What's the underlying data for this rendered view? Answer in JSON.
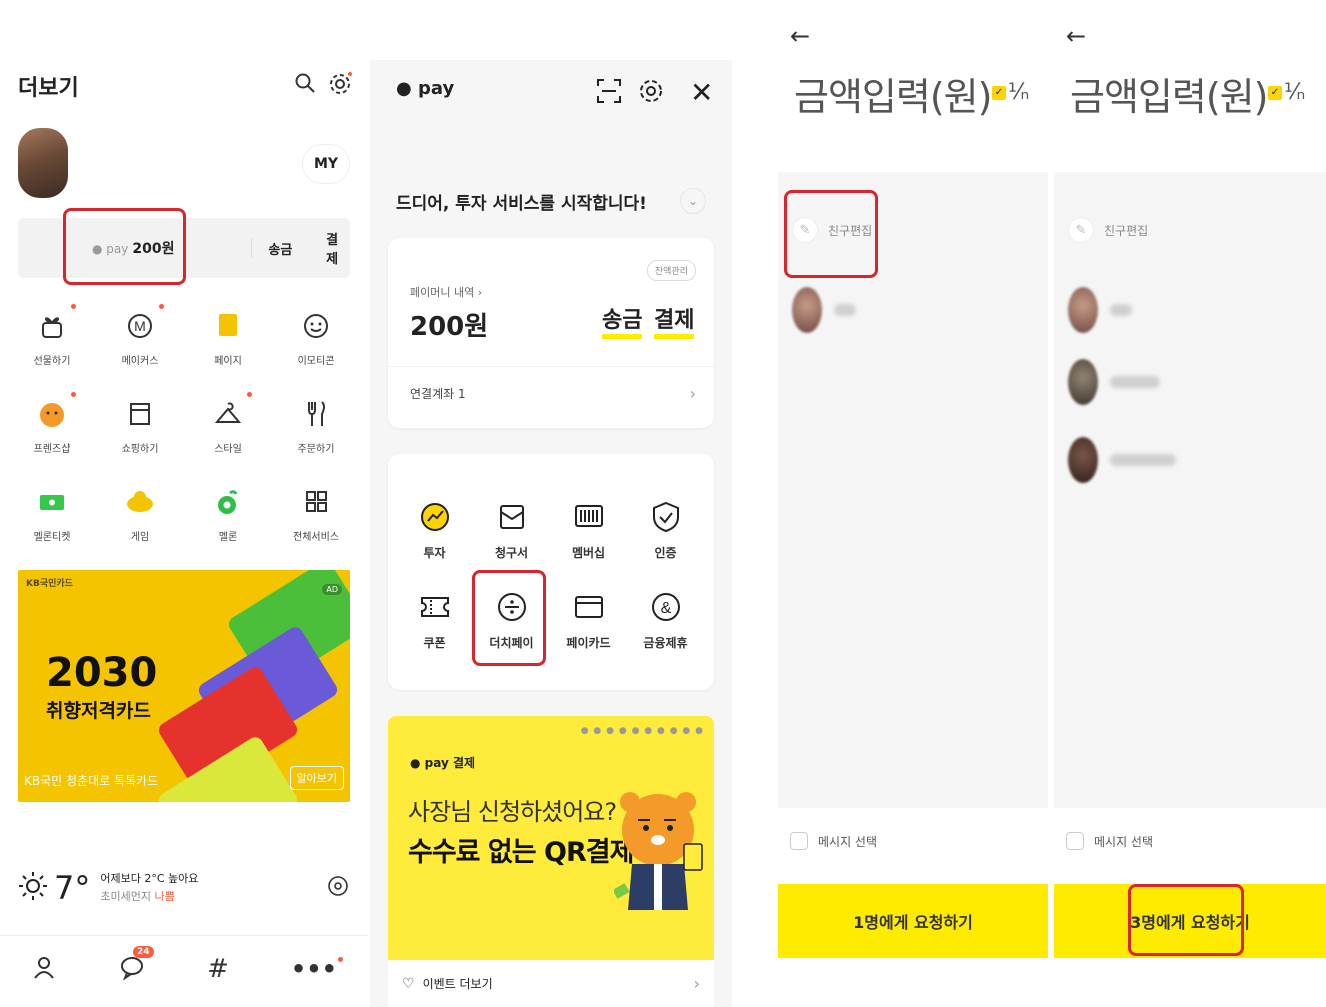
{
  "panel1": {
    "title": "더보기",
    "my_label": "MY",
    "pay": {
      "brand": "pay",
      "amount": "200원",
      "send": "송금",
      "pay_btn": "결제"
    },
    "grid": [
      {
        "label": "선물하기",
        "icon": "gift-icon",
        "badge": true
      },
      {
        "label": "메이커스",
        "icon": "makers-icon",
        "badge": true
      },
      {
        "label": "페이지",
        "icon": "page-icon",
        "badge": false
      },
      {
        "label": "이모티콘",
        "icon": "emoticon-icon",
        "badge": false
      },
      {
        "label": "프렌즈샵",
        "icon": "friends-shop-icon",
        "badge": true
      },
      {
        "label": "쇼핑하기",
        "icon": "shopping-icon",
        "badge": false
      },
      {
        "label": "스타일",
        "icon": "hanger-icon",
        "badge": true
      },
      {
        "label": "주문하기",
        "icon": "fork-knife-icon",
        "badge": false
      },
      {
        "label": "멜론티켓",
        "icon": "ticket-icon",
        "badge": false
      },
      {
        "label": "게임",
        "icon": "game-icon",
        "badge": false
      },
      {
        "label": "멜론",
        "icon": "melon-icon",
        "badge": false
      },
      {
        "label": "전체서비스",
        "icon": "all-services-icon",
        "badge": false
      }
    ],
    "banner": {
      "brand": "KB국민카드",
      "ad": "AD",
      "headline": "2030",
      "subline": "취향저격카드",
      "footer": "KB국민 청춘대로 톡톡카드",
      "cta": "알아보기"
    },
    "weather": {
      "temp": "7°",
      "desc": "어제보다 2°C 높아요",
      "dust_label": "초미세먼지",
      "dust_level": "나쁨"
    },
    "nav": {
      "chat_badge": "24"
    }
  },
  "panel2": {
    "brand": "pay",
    "notice": "드디어, 투자 서비스를 시작합니다!",
    "balance_manage": "잔액관리",
    "history_link": "페이머니 내역 ›",
    "balance": "200원",
    "send": "송금",
    "pay_btn": "결제",
    "linked_account": "연결계좌 1",
    "services": [
      {
        "label": "투자",
        "icon": "invest-icon"
      },
      {
        "label": "청구서",
        "icon": "bill-icon"
      },
      {
        "label": "멤버십",
        "icon": "barcode-icon"
      },
      {
        "label": "인증",
        "icon": "shield-check-icon"
      },
      {
        "label": "쿠폰",
        "icon": "coupon-icon"
      },
      {
        "label": "더치페이",
        "icon": "divide-icon"
      },
      {
        "label": "페이카드",
        "icon": "card-icon"
      },
      {
        "label": "금융제휴",
        "icon": "ampersand-icon"
      }
    ],
    "promo": {
      "tag": "pay 결제",
      "line1": "사장님 신청하셨어요?",
      "line2": "수수료 없는 QR결제"
    },
    "event_more": "이벤트 더보기"
  },
  "panel3": {
    "amount_label": "금액입력(원)",
    "friend_edit": "친구편집",
    "message_select": "메시지 선택",
    "request_btn": "1명에게 요청하기"
  },
  "panel4": {
    "amount_label": "금액입력(원)",
    "friend_edit": "친구편집",
    "message_select": "메시지 선택",
    "request_btn": "3명에게 요청하기"
  },
  "colors": {
    "kakao_yellow": "#ffeb00",
    "highlight_red": "#d9252c",
    "badge_orange": "#ff5a3c"
  }
}
